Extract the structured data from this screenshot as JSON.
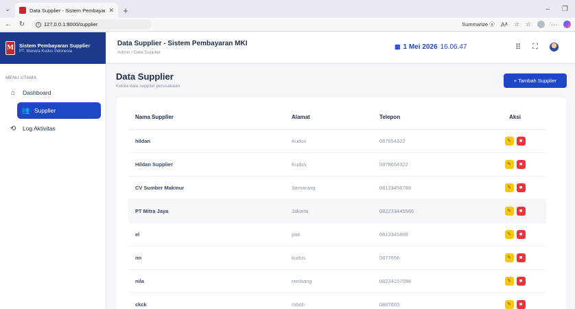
{
  "browser": {
    "tab_title": "Data Supplier - Sistem Pembayara",
    "url": "127.0.0.1:8000/supplier",
    "summarize_label": "Summarize",
    "new_tab": "+"
  },
  "sidebar": {
    "brand_title": "Sistem Pembayaran Supplier",
    "brand_sub": "PT. Manara Kudus Indonesia",
    "menu_heading": "MENU UTAMA",
    "items": [
      {
        "label": "Dashboard",
        "icon": "home-icon"
      },
      {
        "label": "Supplier",
        "icon": "users-icon"
      },
      {
        "label": "Log Aktivitas",
        "icon": "history-icon"
      }
    ]
  },
  "header": {
    "title": "Data Supplier - Sistem Pembayaran MKI",
    "breadcrumb": "Admin / Data Supplier",
    "date": "1 Mei 2026",
    "time": "16.06.47"
  },
  "main": {
    "title": "Data Supplier",
    "subtitle": "Kelola data supplier perusahaan",
    "add_button": "+ Tambah Supplier",
    "columns": [
      "Nama Supplier",
      "Alamat",
      "Telepon",
      "Aksi"
    ],
    "rows": [
      {
        "name": "hildan",
        "address": "Kudus",
        "phone": "087654322"
      },
      {
        "name": "Hildan Supplier",
        "address": "Kudus",
        "phone": "0878654322"
      },
      {
        "name": "CV Sumber Makmur",
        "address": "Semarang",
        "phone": "08123456789"
      },
      {
        "name": "PT Mitra Jaya",
        "address": "Jakarta",
        "phone": "082233445566"
      },
      {
        "name": "el",
        "address": "pati",
        "phone": "0812345868"
      },
      {
        "name": "nn",
        "address": "kudus",
        "phone": "0877656"
      },
      {
        "name": "nila",
        "address": "rembang",
        "phone": "08234157098"
      },
      {
        "name": "ckck",
        "address": "mboh",
        "phone": "0867665"
      }
    ]
  },
  "colors": {
    "brand_blue": "#1b3a8c",
    "accent_blue": "#1f46c7",
    "edit_yellow": "#f5c518",
    "delete_red": "#e8343d"
  }
}
